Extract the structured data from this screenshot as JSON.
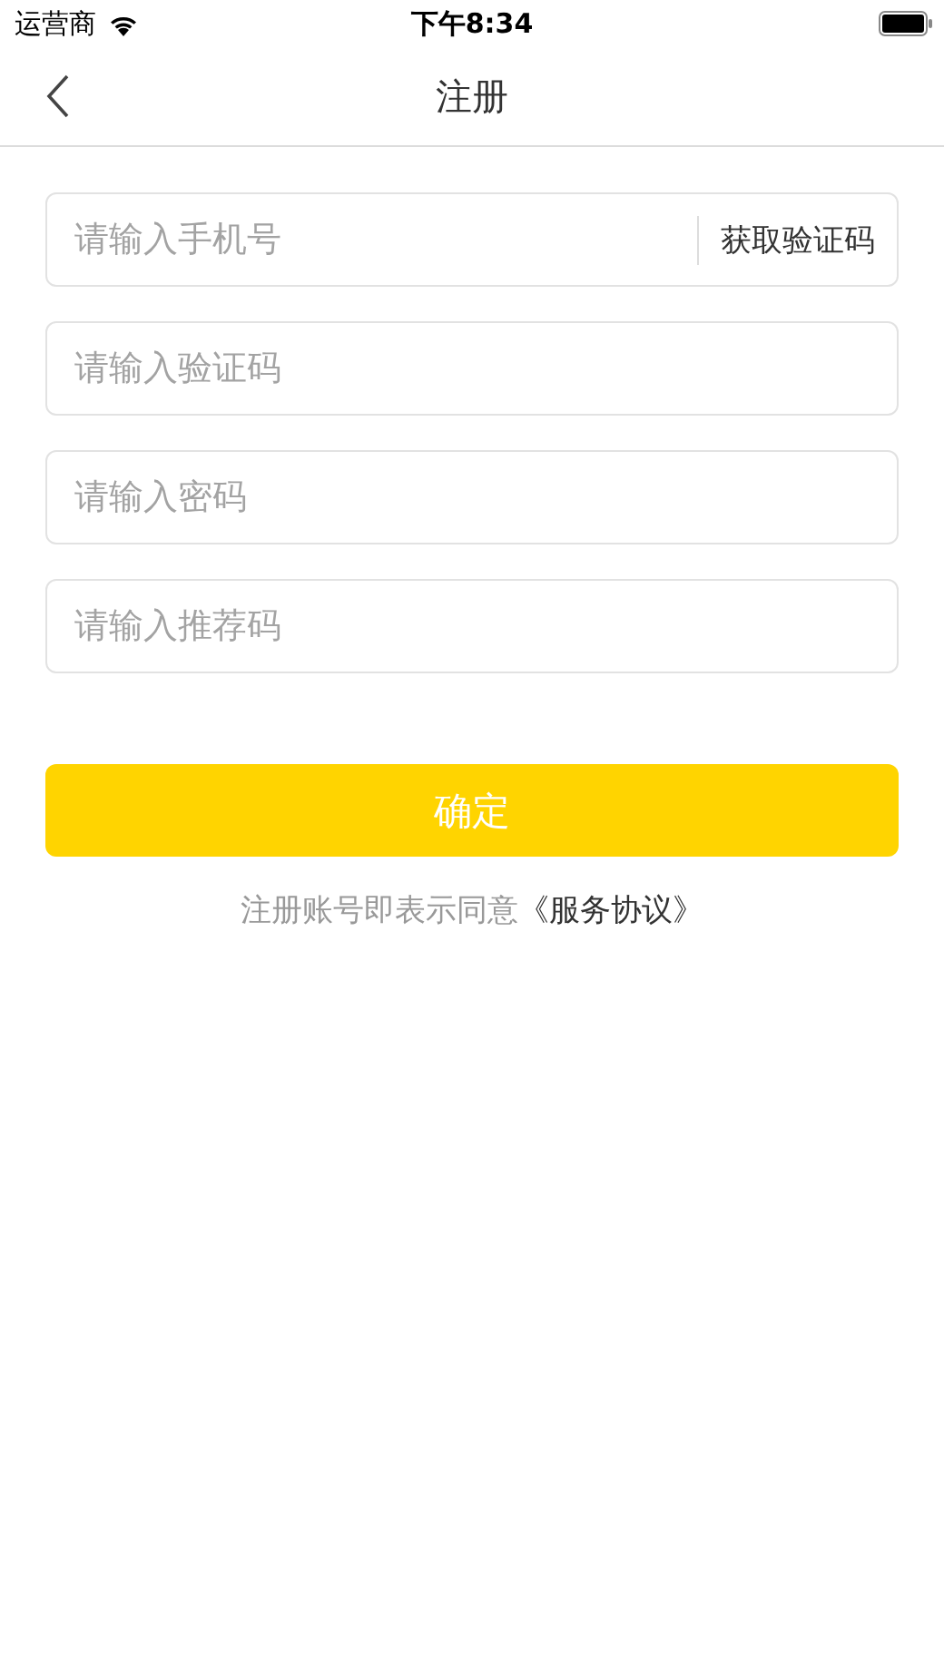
{
  "status_bar": {
    "carrier": "运营商",
    "time": "下午8:34"
  },
  "nav": {
    "title": "注册"
  },
  "fields": [
    {
      "kind": "with_action",
      "placeholder": "请输入手机号",
      "action": "获取验证码"
    },
    {
      "kind": "plain",
      "placeholder": "请输入验证码"
    },
    {
      "kind": "plain",
      "placeholder": "请输入密码"
    },
    {
      "kind": "plain",
      "placeholder": "请输入推荐码"
    }
  ],
  "submit": "确定",
  "agreement": {
    "text": "注册账号即表示同意",
    "link": "《服务协议》"
  }
}
